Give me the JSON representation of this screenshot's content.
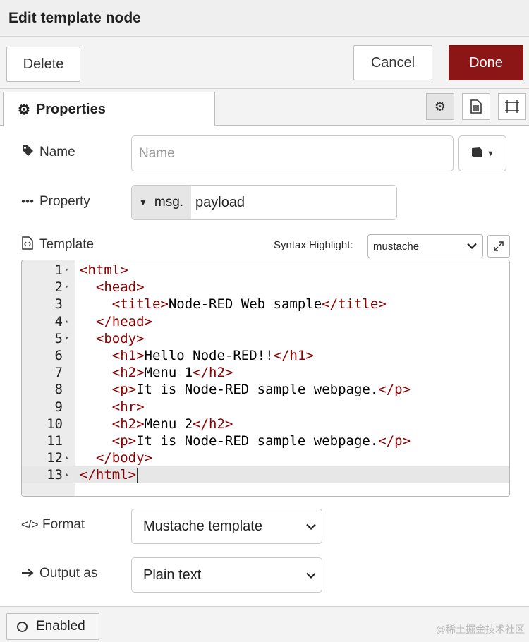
{
  "dialog": {
    "title": "Edit template node"
  },
  "toolbar": {
    "delete_label": "Delete",
    "cancel_label": "Cancel",
    "done_label": "Done",
    "done_color": "#8c1515"
  },
  "tabs": {
    "properties_label": "Properties",
    "icons": [
      "gear-icon",
      "document-icon",
      "frame-icon"
    ]
  },
  "fields": {
    "name": {
      "label": "Name",
      "value": "",
      "placeholder": "Name"
    },
    "property": {
      "label": "Property",
      "type": "msg.",
      "value": "payload"
    },
    "template": {
      "label": "Template",
      "syntax_label": "Syntax Highlight:",
      "syntax_value": "mustache",
      "lines": [
        {
          "num": "1",
          "fold": "▾",
          "text": "<html>"
        },
        {
          "num": "2",
          "fold": "▾",
          "text": "  <head>"
        },
        {
          "num": "3",
          "fold": "",
          "text": "    <title>Node-RED Web sample</title>"
        },
        {
          "num": "4",
          "fold": "▴",
          "text": "  </head>"
        },
        {
          "num": "5",
          "fold": "▾",
          "text": "  <body>"
        },
        {
          "num": "6",
          "fold": "",
          "text": "    <h1>Hello Node-RED!!</h1>"
        },
        {
          "num": "7",
          "fold": "",
          "text": "    <h2>Menu 1</h2>"
        },
        {
          "num": "8",
          "fold": "",
          "text": "    <p>It is Node-RED sample webpage.</p>"
        },
        {
          "num": "9",
          "fold": "",
          "text": "    <hr>"
        },
        {
          "num": "10",
          "fold": "",
          "text": "    <h2>Menu 2</h2>"
        },
        {
          "num": "11",
          "fold": "",
          "text": "    <p>It is Node-RED sample webpage.</p>"
        },
        {
          "num": "12",
          "fold": "▴",
          "text": "  </body>"
        },
        {
          "num": "13",
          "fold": "▴",
          "text": "</html>"
        }
      ],
      "current_line": 13
    },
    "format": {
      "label": "Format",
      "value": "Mustache template"
    },
    "output": {
      "label": "Output as",
      "value": "Plain text"
    }
  },
  "footer": {
    "enabled_label": "Enabled",
    "watermark": "@稀土掘金技术社区"
  }
}
